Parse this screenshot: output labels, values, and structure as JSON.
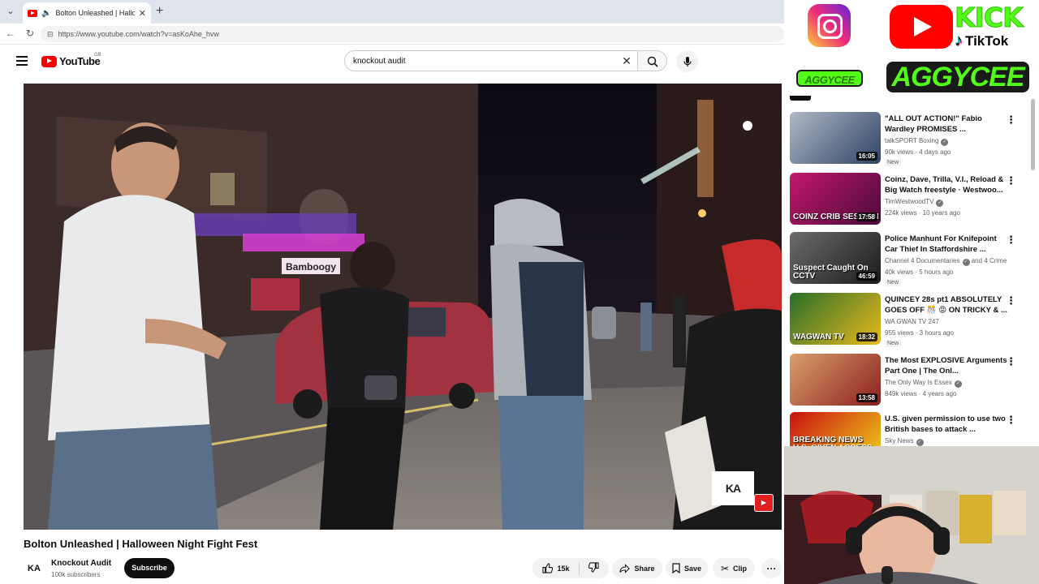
{
  "browser": {
    "tab_title": "Bolton Unleashed | Halloween Night Fight Fest",
    "new_tab": "+",
    "url": "https://www.youtube.com/watch?v=asKoAhe_hvw"
  },
  "header": {
    "logo_text": "YouTube",
    "logo_country": "GB",
    "search_value": "knockout audit"
  },
  "player": {
    "watermark": "KA",
    "overlay_storefront": "Bamboogy"
  },
  "video": {
    "title": "Bolton Unleashed | Halloween Night Fight Fest",
    "channel_avatar_text": "KA",
    "channel_name": "Knockout Audit",
    "channel_subs": "100k subscribers",
    "subscribe_label": "Subscribe",
    "like_count": "15k",
    "share_label": "Share",
    "save_label": "Save",
    "clip_label": "Clip",
    "more_label": "···"
  },
  "overlay": {
    "kick_text": "KICK",
    "tiktok_text": "TikTok",
    "aggy_small": "AGGYCEE",
    "aggy_big": "AGGYCEE"
  },
  "recommendations": [
    {
      "title": "\"ALL OUT ACTION!\" Fabio Wardley PROMISES ...",
      "channel": "talkSPORT Boxing",
      "verified": true,
      "meta": "90k views · 4 days ago",
      "badge": "New",
      "duration": "16:05",
      "thumb_overlay": "",
      "colors": [
        "#b0b8c6",
        "#2f4466"
      ]
    },
    {
      "title": "Coinz, Dave, Trilla, V.I., Reload & Big Watch freestyle · Westwoo...",
      "channel": "TimWestwoodTV",
      "verified": true,
      "meta": "224k views · 10 years ago",
      "badge": "",
      "duration": "17:58",
      "thumb_overlay": "COINZ CRIB SESSION",
      "colors": [
        "#c2186b",
        "#4a0a3a"
      ]
    },
    {
      "title": "Police Manhunt For Knifepoint Car Thief In Staffordshire ...",
      "channel": "Channel 4 Documentaries",
      "verified": true,
      "channel_extra": "and 4 Crime",
      "meta": "40k views · 5 hours ago",
      "badge": "New",
      "duration": "46:59",
      "thumb_overlay": "Suspect Caught On CCTV",
      "colors": [
        "#6b6b6b",
        "#1c1c1c"
      ]
    },
    {
      "title": "QUINCEY 28s pt1 ABSOLUTELY GOES OFF 🎊 😡 ON TRICKY & ...",
      "channel": "WA GWAN TV 247",
      "verified": false,
      "meta": "955 views · 3 hours ago",
      "badge": "New",
      "duration": "18:32",
      "thumb_overlay": "WAGWAN TV",
      "colors": [
        "#2a6e2a",
        "#e8b91c"
      ]
    },
    {
      "title": "The Most EXPLOSIVE Arguments Part One | The Onl...",
      "channel": "The Only Way Is Essex",
      "verified": true,
      "meta": "849k views · 4 years ago",
      "badge": "",
      "duration": "13:58",
      "thumb_overlay": "",
      "colors": [
        "#d9a06a",
        "#8a1f1f"
      ]
    },
    {
      "title": "U.S. given permission to use two British bases to attack ...",
      "channel": "Sky News",
      "verified": true,
      "meta": "",
      "badge": "",
      "duration": "",
      "thumb_overlay": "BREAKING NEWS U.S. GIVEN ACCESS TO TWO",
      "colors": [
        "#c81010",
        "#f2d21a"
      ]
    }
  ]
}
